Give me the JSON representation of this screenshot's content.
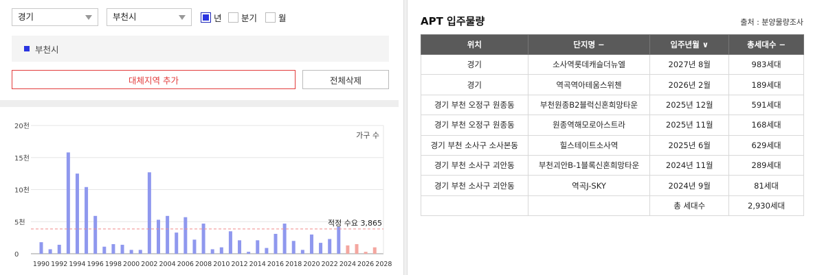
{
  "filters": {
    "region": "경기",
    "city": "부천시",
    "period_options": [
      {
        "label": "년",
        "checked": true
      },
      {
        "label": "분기",
        "checked": false
      },
      {
        "label": "월",
        "checked": false
      }
    ]
  },
  "legend": {
    "label": "부천시",
    "color": "#2a35e0"
  },
  "buttons": {
    "add": "대체지역 추가",
    "clear": "전체삭제"
  },
  "chart_data": {
    "type": "bar",
    "ylabel": "가구 수",
    "y_ticks": [
      "0",
      "5천",
      "10천",
      "15천",
      "20천"
    ],
    "ylim": [
      0,
      20000
    ],
    "x_tick_labels": [
      "1990",
      "1992",
      "1994",
      "1996",
      "1998",
      "2000",
      "2002",
      "2004",
      "2006",
      "2008",
      "2010",
      "2012",
      "2014",
      "2016",
      "2018",
      "2020",
      "2022",
      "2024",
      "2026",
      "2028"
    ],
    "categories": [
      "1990",
      "1991",
      "1992",
      "1993",
      "1994",
      "1995",
      "1996",
      "1997",
      "1998",
      "1999",
      "2000",
      "2001",
      "2002",
      "2003",
      "2004",
      "2005",
      "2006",
      "2007",
      "2008",
      "2009",
      "2010",
      "2011",
      "2012",
      "2013",
      "2014",
      "2015",
      "2016",
      "2017",
      "2018",
      "2019",
      "2020",
      "2021",
      "2022",
      "2023",
      "2024",
      "2025",
      "2026",
      "2027"
    ],
    "values": [
      1800,
      700,
      1400,
      15800,
      12500,
      10400,
      5900,
      1100,
      1500,
      1400,
      600,
      600,
      12700,
      5300,
      5900,
      3300,
      5700,
      2200,
      4700,
      700,
      1000,
      3500,
      2100,
      300,
      2100,
      900,
      3100,
      4700,
      2000,
      600,
      3000,
      1700,
      2300,
      4200,
      1300,
      1500,
      300,
      1000
    ],
    "actual_color": "#8f98ee",
    "forecast_color": "#f4a7a0",
    "forecast_from": "2024",
    "reference_line": {
      "label": "적정 수요 3,865",
      "value": 3865,
      "color": "#f08a8a"
    },
    "grid": true
  },
  "table": {
    "title": "APT 입주물량",
    "source": "출처 : 분양물량조사",
    "headers": [
      "위치",
      "단지명 −",
      "입주년월 ∨",
      "총세대수 −"
    ],
    "rows": [
      [
        "경기",
        "소사역롯데캐슬더뉴엘",
        "2027년 8월",
        "983세대"
      ],
      [
        "경기",
        "역곡역아테움스위첸",
        "2026년 2월",
        "189세대"
      ],
      [
        "경기 부천 오정구 원종동",
        "부천원종B2블럭신혼희망타운",
        "2025년 12월",
        "591세대"
      ],
      [
        "경기 부천 오정구 원종동",
        "원종역해모로아스트라",
        "2025년 11월",
        "168세대"
      ],
      [
        "경기 부천 소사구 소사본동",
        "힐스테이트소사역",
        "2025년 6월",
        "629세대"
      ],
      [
        "경기 부천 소사구 괴안동",
        "부천괴안B-1블록신혼희망타운",
        "2024년 11월",
        "289세대"
      ],
      [
        "경기 부천 소사구 괴안동",
        "역곡J-SKY",
        "2024년 9월",
        "81세대"
      ]
    ],
    "total": {
      "label": "총 세대수",
      "value": "2,930세대"
    }
  }
}
